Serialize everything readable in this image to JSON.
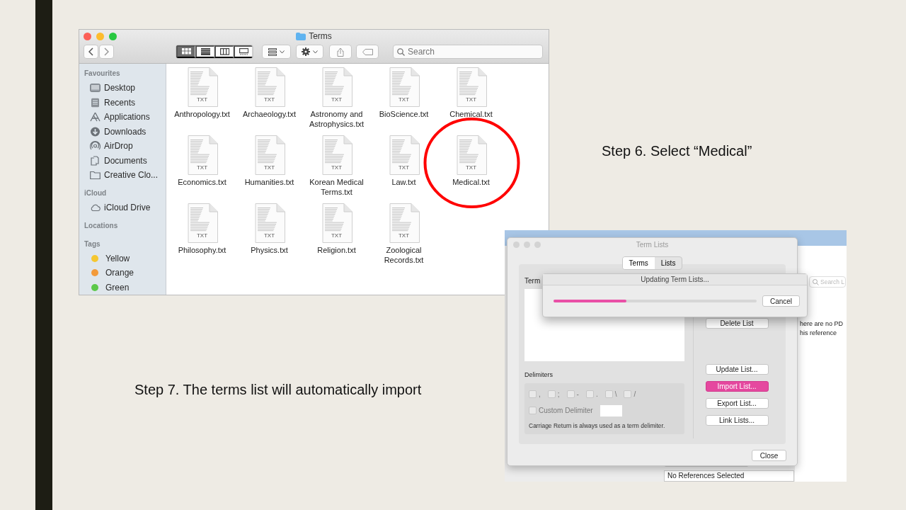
{
  "finder": {
    "title": "Terms",
    "view_modes": [
      {
        "selected": true
      },
      {
        "selected": false
      },
      {
        "selected": false
      },
      {
        "selected": false
      }
    ],
    "search": {
      "placeholder": "Search"
    },
    "sidebar": [
      {
        "heading": "Favourites",
        "items": [
          {
            "label": "Desktop"
          },
          {
            "label": "Recents"
          },
          {
            "label": "Applications"
          },
          {
            "label": "Downloads"
          },
          {
            "label": "AirDrop"
          },
          {
            "label": "Documents"
          },
          {
            "label": "Creative Clo..."
          }
        ]
      },
      {
        "heading": "iCloud",
        "items": [
          {
            "label": "iCloud Drive"
          }
        ]
      },
      {
        "heading": "Locations"
      },
      {
        "heading": "Tags",
        "items": [
          {
            "label": "Yellow",
            "color": "#f5c730"
          },
          {
            "label": "Orange",
            "color": "#f39a3a"
          },
          {
            "label": "Green",
            "color": "#5cc84a"
          }
        ]
      }
    ],
    "files": [
      {
        "name": "Anthropology.txt",
        "type": "TXT"
      },
      {
        "name": "Archaeology.txt",
        "type": "TXT"
      },
      {
        "name": "Astronomy and Astrophysics.txt",
        "type": "TXT"
      },
      {
        "name": "BioScience.txt",
        "type": "TXT"
      },
      {
        "name": "Chemical.txt",
        "type": "TXT"
      },
      {
        "name": "Economics.txt",
        "type": "TXT"
      },
      {
        "name": "Humanities.txt",
        "type": "TXT"
      },
      {
        "name": "Korean Medical Terms.txt",
        "type": "TXT"
      },
      {
        "name": "Law.txt",
        "type": "TXT"
      },
      {
        "name": "Medical.txt",
        "type": "TXT",
        "circled": true
      },
      {
        "name": "Philosophy.txt",
        "type": "TXT"
      },
      {
        "name": "Physics.txt",
        "type": "TXT"
      },
      {
        "name": "Religion.txt",
        "type": "TXT"
      },
      {
        "name": "Zoological Records.txt",
        "type": "TXT"
      }
    ]
  },
  "step6": "Step 6. Select “Medical”",
  "step7": "Step 7. The terms list will automatically import",
  "term_lists": {
    "title": "Term Lists",
    "tabs": [
      {
        "label": "Terms",
        "selected": true
      },
      {
        "label": "Lists",
        "selected": false
      }
    ],
    "list_label": "Term",
    "delimiters_heading": "Delimiters",
    "delimiters": [
      {
        "label": ",",
        "checked": false
      },
      {
        "label": ";",
        "checked": false
      },
      {
        "label": "-",
        "checked": false
      },
      {
        "label": ".",
        "checked": false
      },
      {
        "label": "\\",
        "checked": false
      },
      {
        "label": "/",
        "checked": false
      }
    ],
    "custom_delimiter": {
      "label": "Custom Delimiter",
      "checked": false
    },
    "note": "Carriage Return is always used as a term delimiter.",
    "buttons": [
      {
        "label": "Delete List",
        "default": false
      },
      {
        "label": "Update List...",
        "default": false
      },
      {
        "label": "Import List...",
        "default": true
      },
      {
        "label": "Export List...",
        "default": false
      },
      {
        "label": "Link Lists...",
        "default": false
      }
    ],
    "close": "Close",
    "progress_dialog": {
      "title": "Updating Term Lists...",
      "level": 0.36,
      "cancel": "Cancel"
    },
    "background": {
      "search_placeholder": "Search L",
      "message_lines": [
        "here are no PD",
        "his reference"
      ],
      "status": "No References Selected"
    }
  }
}
